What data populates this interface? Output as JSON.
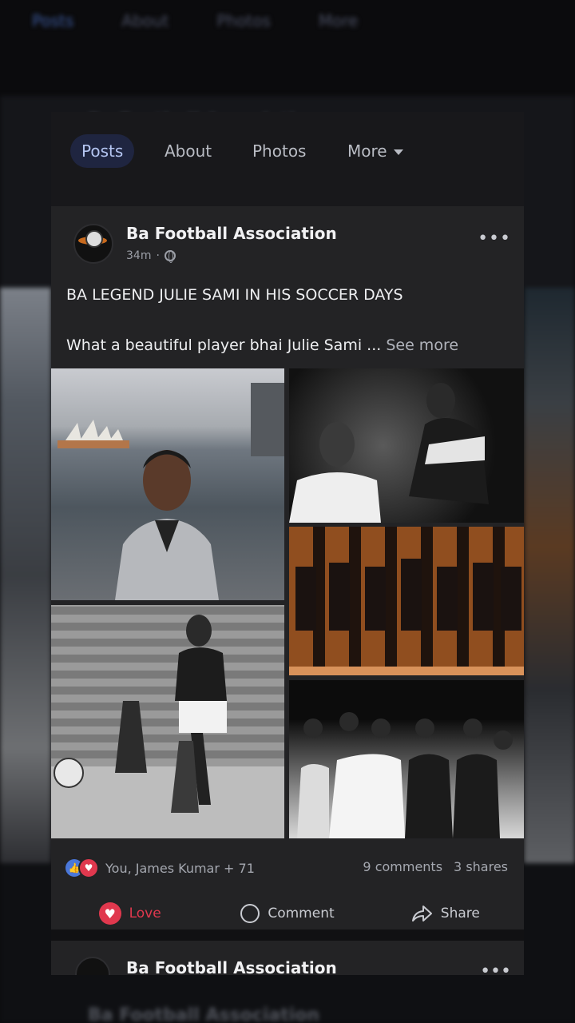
{
  "background": {
    "tabs": [
      "Posts",
      "About",
      "Photos",
      "More"
    ],
    "page_title": "Ba Football Association"
  },
  "tabs": [
    {
      "label": "Posts",
      "active": true
    },
    {
      "label": "About",
      "active": false
    },
    {
      "label": "Photos",
      "active": false
    },
    {
      "label": "More",
      "active": false
    }
  ],
  "post": {
    "page_name": "Ba Football Association",
    "time": "34m",
    "headline": "BA LEGEND JULIE SAMI IN HIS SOCCER DAYS",
    "body_preview": "What a beautiful player bhai Julie Sami ...",
    "see_more": "See more",
    "reactions_text": "You, James Kumar + 71",
    "comments": "9 comments",
    "shares": "3 shares",
    "actions": {
      "love": "Love",
      "comment": "Comment",
      "share": "Share"
    }
  },
  "next_post": {
    "page_name": "Ba Football Association"
  },
  "colors": {
    "accent_tab": "#1f2540",
    "love": "#e0384e",
    "like": "#4a77d9"
  }
}
